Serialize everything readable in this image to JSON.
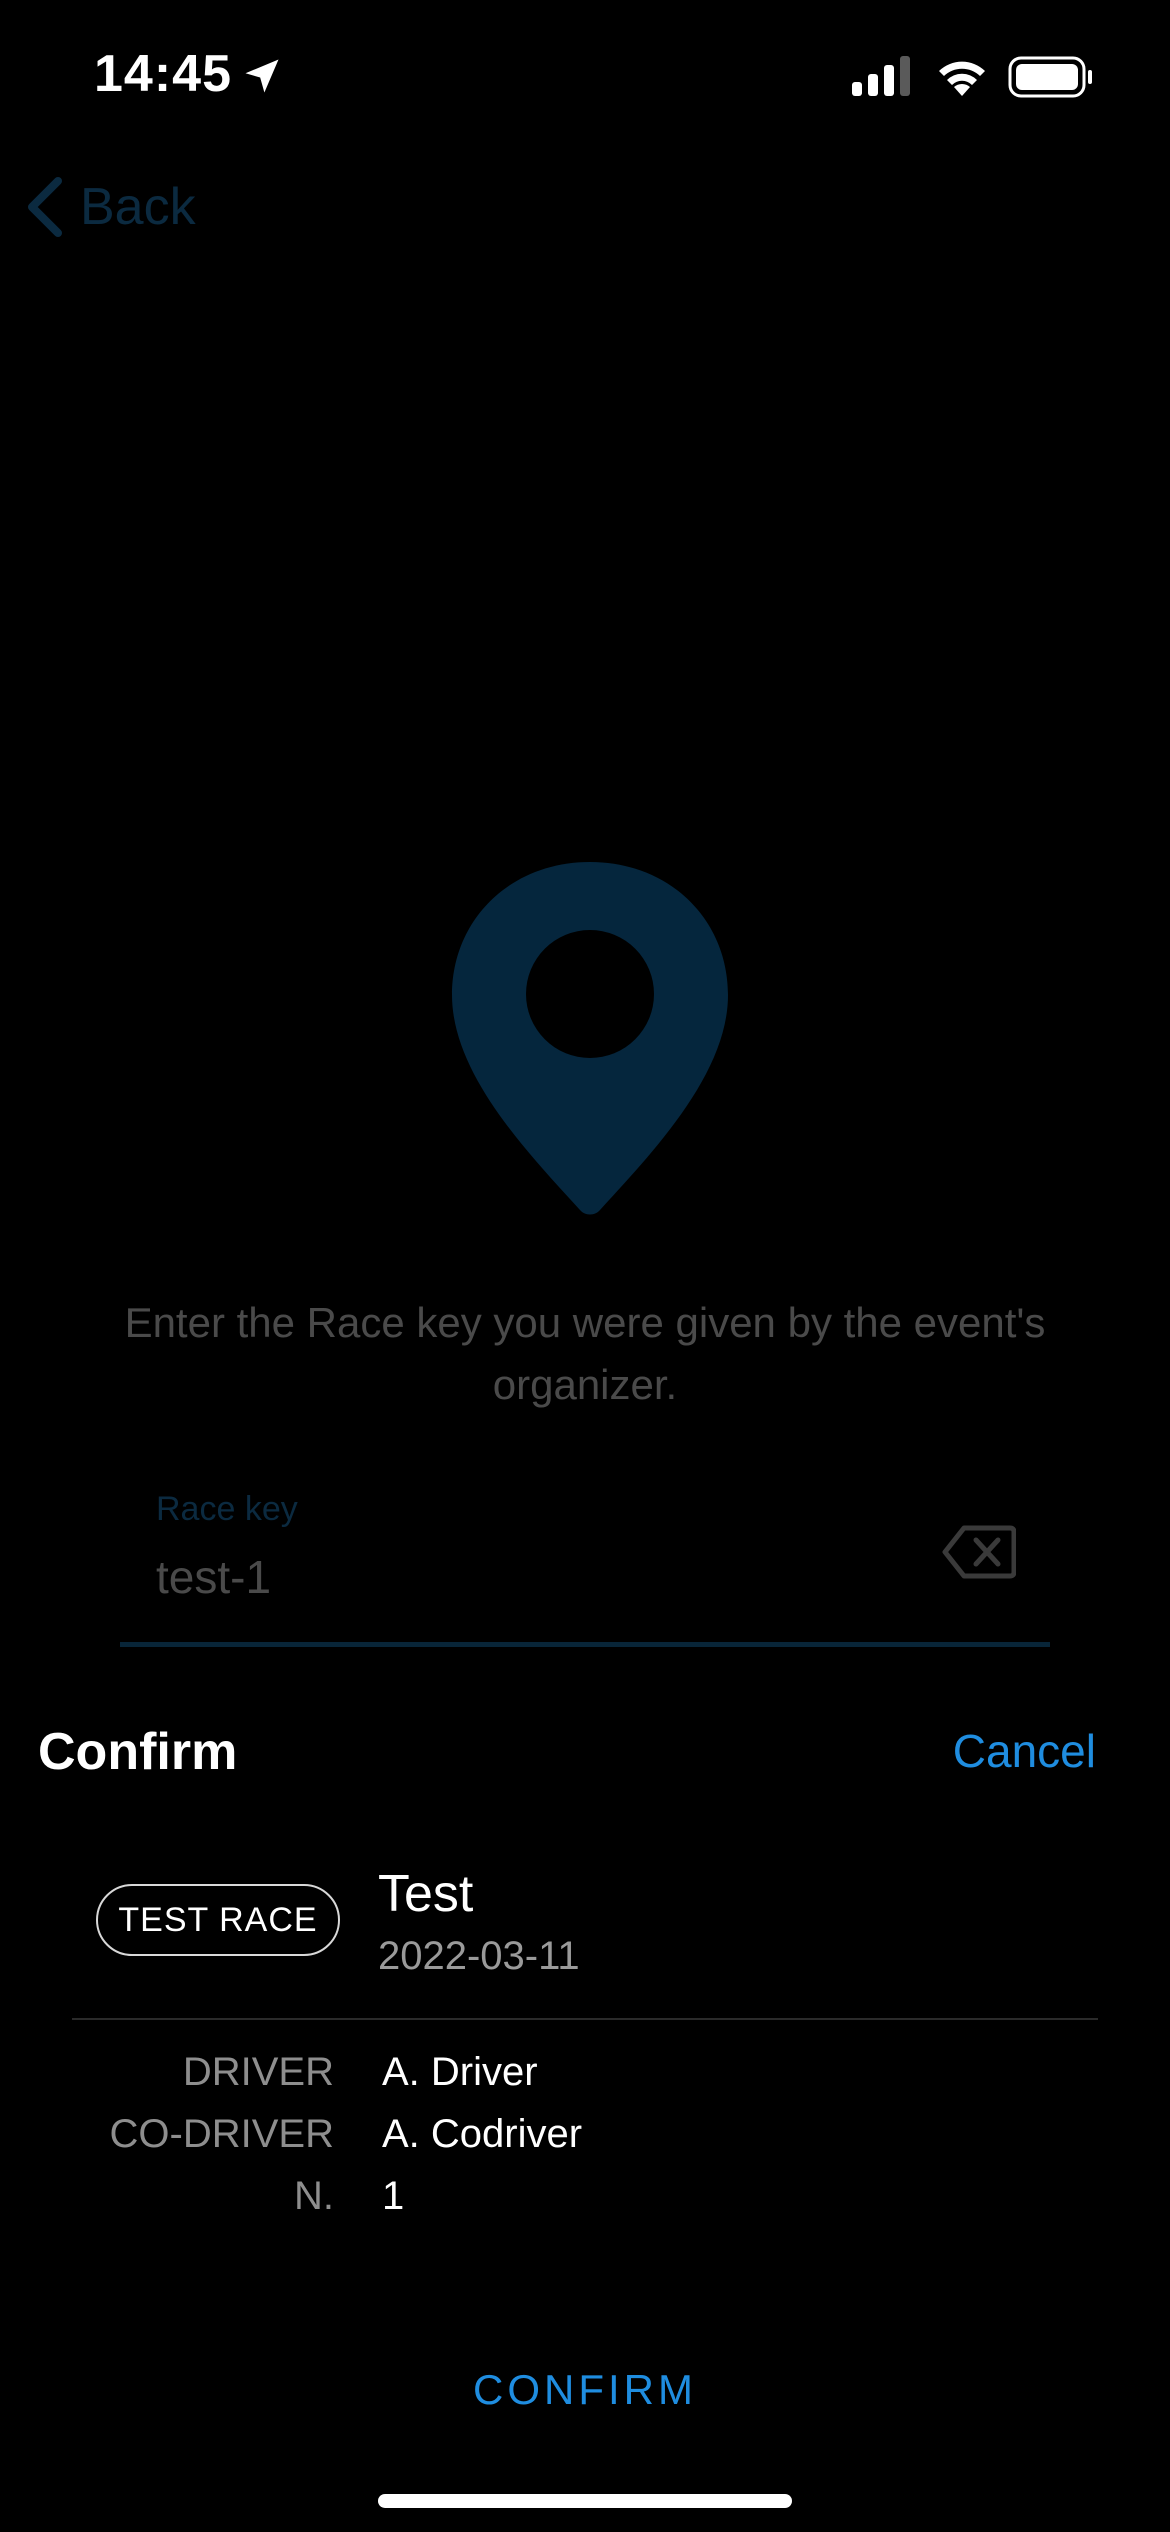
{
  "status_bar": {
    "time": "14:45"
  },
  "nav": {
    "back_label": "Back"
  },
  "entry": {
    "instructions": "Enter the Race key you were given by the event's organizer.",
    "race_key_label": "Race key",
    "race_key_value": "test-1"
  },
  "sheet": {
    "title": "Confirm",
    "cancel_label": "Cancel",
    "badge": "TEST RACE",
    "race_name": "Test",
    "race_date": "2022-03-11",
    "details": {
      "driver_label": "DRIVER",
      "driver_value": "A. Driver",
      "codriver_label": "CO-DRIVER",
      "codriver_value": "A. Codriver",
      "number_label": "N.",
      "number_value": "1"
    },
    "confirm_label": "CONFIRM"
  },
  "colors": {
    "accent": "#1f8de0",
    "dimmed_accent": "#0b2a40",
    "background": "#000000"
  }
}
